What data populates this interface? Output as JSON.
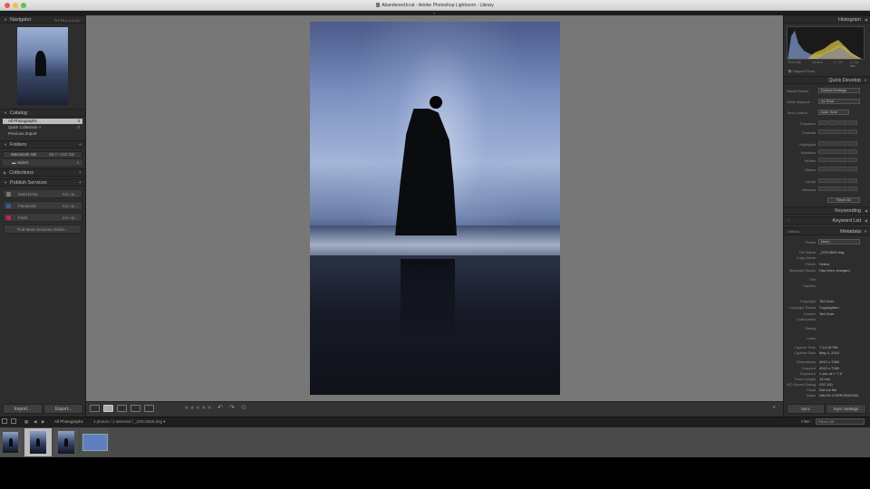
{
  "window": {
    "title": "Abandoned.lrcat - Adobe Photoshop Lightroom - Library"
  },
  "left": {
    "navigator": {
      "title": "Navigator",
      "modes": "FIT  FILL  1:1  3:1"
    },
    "catalog": {
      "title": "Catalog",
      "items": [
        {
          "label": "All Photographs",
          "count": "4"
        },
        {
          "label": "Quick Collection +",
          "count": "0"
        },
        {
          "label": "Previous Import",
          "count": ""
        }
      ]
    },
    "folders": {
      "title": "Folders",
      "volume": {
        "label": "Macintosh HD",
        "count": "95.7 / 233 GB"
      },
      "sub": {
        "label": "Select",
        "count": "4"
      }
    },
    "collections": {
      "title": "Collections"
    },
    "publish": {
      "title": "Publish Services",
      "items": [
        {
          "label": "Hard Drive",
          "setup": "Set Up...",
          "color": "#777777"
        },
        {
          "label": "Facebook",
          "setup": "Set Up...",
          "color": "#3b5998"
        },
        {
          "label": "Flickr",
          "setup": "Set Up...",
          "color": "#cc2255"
        }
      ],
      "find_more": "Find More Services Online..."
    },
    "import_label": "Import...",
    "export_label": "Export..."
  },
  "toolbar": {
    "stars": "★★★★★"
  },
  "right": {
    "histogram": {
      "title": "Histogram",
      "iso": "ISO 100",
      "focal": "14 mm",
      "aperture": "f / 7.0",
      "shutter": "1 / 11 sec",
      "original_photo": "Original Photo"
    },
    "quick_develop": {
      "title": "Quick Develop",
      "saved_preset_label": "Saved Preset",
      "saved_preset_value": "Default Settings",
      "white_balance_label": "White Balance",
      "white_balance_value": "As Shot",
      "tone_control_label": "Tone Control",
      "tone_control_value": "Auto Tone",
      "rows": [
        "Exposure",
        "Contrast",
        "Highlights",
        "Shadows",
        "Whites",
        "Blacks",
        "Clarity",
        "Vibrance"
      ],
      "reset_label": "Reset All"
    },
    "keywording": {
      "title": "Keywording"
    },
    "keyword_list": {
      "title": "Keyword List"
    },
    "metadata": {
      "title": "Metadata",
      "preset_mode": "Default",
      "preset_label": "Preset",
      "preset_value": "None",
      "fields": [
        {
          "label": "File Name",
          "value": "_DSC3629.dng"
        },
        {
          "label": "Copy Name",
          "value": ""
        },
        {
          "label": "Folder",
          "value": "Select"
        },
        {
          "label": "Metadata Status",
          "value": "Has been changed"
        },
        {
          "label": "Title",
          "value": ""
        },
        {
          "label": "Caption",
          "value": ""
        }
      ],
      "fields2": [
        {
          "label": "Copyright",
          "value": "Ted Gore"
        },
        {
          "label": "Copyright Status",
          "value": "Copyrighted"
        },
        {
          "label": "Creator",
          "value": "Ted Gore"
        },
        {
          "label": "Sublocation",
          "value": ""
        }
      ],
      "rating_label": "Rating",
      "rating_value": "· · · · ·",
      "label_label": "Label",
      "fields3": [
        {
          "label": "Capture Time",
          "value": "7:14:15 PM"
        },
        {
          "label": "Capture Date",
          "value": "May 4, 2014"
        }
      ],
      "fields4": [
        {
          "label": "Dimensions",
          "value": "4912 x 7360"
        },
        {
          "label": "Cropped",
          "value": "4912 x 7360"
        },
        {
          "label": "Exposure",
          "value": "1 sec at f / 7.0"
        },
        {
          "label": "Focal Length",
          "value": "14 mm"
        },
        {
          "label": "ISO Speed Rating",
          "value": "ISO 100"
        },
        {
          "label": "Flash",
          "value": "Did not fire"
        },
        {
          "label": "Make",
          "value": "NIKON CORPORATION"
        }
      ]
    },
    "sync_label": "Sync",
    "sync_settings_label": "Sync Settings"
  },
  "filmstrip_bar": {
    "source": "All Photographs",
    "info": "4 photos / 1 selected / _DSC3629.dng ▾",
    "filter_label": "Filter :",
    "filter_value": "Filters Off"
  },
  "colors": {
    "panel": "#2d2d2d",
    "center": "#777777",
    "accent_sel": "#bbbbbb"
  }
}
